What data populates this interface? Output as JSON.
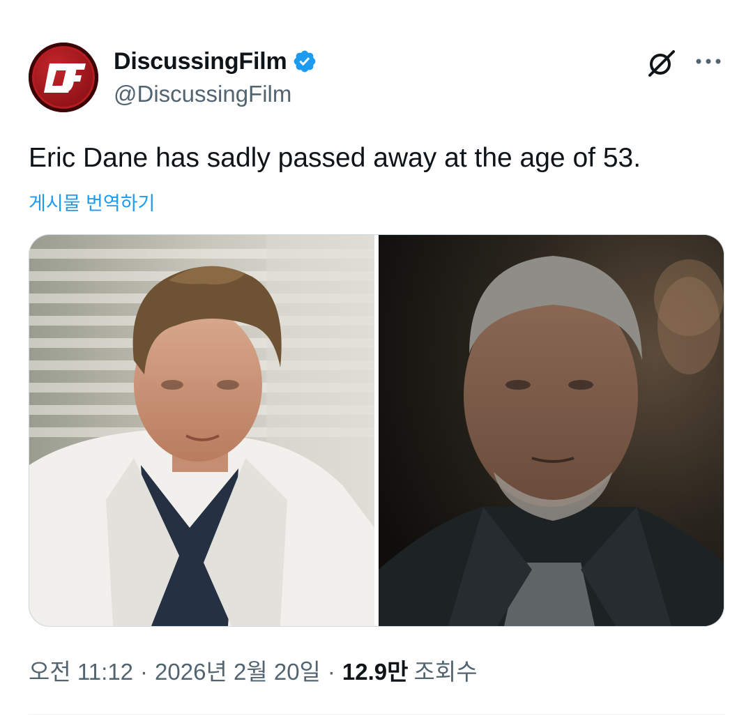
{
  "author": {
    "display_name": "DiscussingFilm",
    "handle": "@DiscussingFilm",
    "avatar_icon": "discussingfilm-logo-icon",
    "verified": true,
    "verified_color": "#1d9bf0"
  },
  "tweet": {
    "text": "Eric Dane has sadly passed away at the age of 53.",
    "translate_label": "게시물 번역하기",
    "media": [
      {
        "name": "photo-white-coat"
      },
      {
        "name": "photo-dark-jacket"
      }
    ]
  },
  "meta": {
    "time": "오전 11:12",
    "date": "2026년 2월 20일",
    "views_count": "12.9만",
    "views_label": "조회수",
    "separator": "·"
  },
  "actions": {
    "grok_icon": "grok-icon",
    "more_icon": "more-dots-icon"
  },
  "colors": {
    "accent": "#1d9bf0",
    "text_primary": "#0f1419",
    "text_secondary": "#536471"
  }
}
